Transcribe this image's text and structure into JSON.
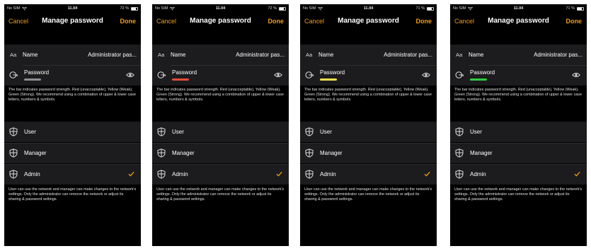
{
  "colors": {
    "accent": "#f39c12",
    "background": "#000000",
    "cell": "#1c1c1e",
    "strength_unacceptable": "#e74c3c",
    "strength_weak": "#f4e04d",
    "strength_strong": "#2ecc40",
    "strength_empty": "#8e8e93"
  },
  "screens": [
    {
      "status": {
        "carrier": "No SIM",
        "time": "11.04",
        "battery": "72 %",
        "battery_level": 0.72
      },
      "nav": {
        "cancel": "Cancel",
        "title": "Manage password",
        "done": "Done"
      },
      "name_row": {
        "icon_text": "Aa",
        "label": "Name",
        "value": "Administrator pas..."
      },
      "password_row": {
        "icon": "key-icon",
        "label": "Password",
        "strength": "empty",
        "reveal_icon": "eye-icon"
      },
      "hint": "The bar indicates password strength. Red (unacceptable), Yellow (Weak), Green (Strong). We recommend using a combination of upper & lower case letters, numbers & symbols.",
      "roles": [
        {
          "label": "User",
          "icon": "shield-icon",
          "selected": false
        },
        {
          "label": "Manager",
          "icon": "shield-icon",
          "selected": false
        },
        {
          "label": "Admin",
          "icon": "shield-icon",
          "selected": true
        }
      ],
      "footer": "User can use the network and manager can make changes to the network's settings. Only the administrator can remove the network or adjust its sharing & password settings."
    },
    {
      "status": {
        "carrier": "No SIM",
        "time": "11.04",
        "battery": "72 %",
        "battery_level": 0.72
      },
      "nav": {
        "cancel": "Cancel",
        "title": "Manage password",
        "done": "Done"
      },
      "name_row": {
        "icon_text": "Aa",
        "label": "Name",
        "value": "Administrator pas..."
      },
      "password_row": {
        "icon": "key-icon",
        "label": "Password",
        "strength": "unacceptable",
        "reveal_icon": "eye-icon"
      },
      "hint": "The bar indicates password strength. Red (unacceptable), Yellow (Weak), Green (Strong). We recommend using a combination of upper & lower case letters, numbers & symbols.",
      "roles": [
        {
          "label": "User",
          "icon": "shield-icon",
          "selected": false
        },
        {
          "label": "Manager",
          "icon": "shield-icon",
          "selected": false
        },
        {
          "label": "Admin",
          "icon": "shield-icon",
          "selected": true
        }
      ],
      "footer": "User can use the network and manager can make changes to the network's settings. Only the administrator can remove the network or adjust its sharing & password settings."
    },
    {
      "status": {
        "carrier": "No SIM",
        "time": "11.04",
        "battery": "71 %",
        "battery_level": 0.71
      },
      "nav": {
        "cancel": "Cancel",
        "title": "Manage password",
        "done": "Done"
      },
      "name_row": {
        "icon_text": "Aa",
        "label": "Name",
        "value": "Administrator pas..."
      },
      "password_row": {
        "icon": "key-icon",
        "label": "Password",
        "strength": "weak",
        "reveal_icon": "eye-icon"
      },
      "hint": "The bar indicates password strength. Red (unacceptable), Yellow (Weak), Green (Strong). We recommend using a combination of upper & lower case letters, numbers & symbols.",
      "roles": [
        {
          "label": "User",
          "icon": "shield-icon",
          "selected": false
        },
        {
          "label": "Manager",
          "icon": "shield-icon",
          "selected": false
        },
        {
          "label": "Admin",
          "icon": "shield-icon",
          "selected": true
        }
      ],
      "footer": "User can use the network and manager can make changes to the network's settings. Only the administrator can remove the network or adjust its sharing & password settings."
    },
    {
      "status": {
        "carrier": "No SIM",
        "time": "11.04",
        "battery": "71 %",
        "battery_level": 0.71
      },
      "nav": {
        "cancel": "Cancel",
        "title": "Manage password",
        "done": "Done"
      },
      "name_row": {
        "icon_text": "Aa",
        "label": "Name",
        "value": "Administrator pas..."
      },
      "password_row": {
        "icon": "key-icon",
        "label": "Password",
        "strength": "strong",
        "reveal_icon": "eye-icon"
      },
      "hint": "The bar indicates password strength. Red (unacceptable), Yellow (Weak), Green (Strong). We recommend using a combination of upper & lower case letters, numbers & symbols.",
      "roles": [
        {
          "label": "User",
          "icon": "shield-icon",
          "selected": false
        },
        {
          "label": "Manager",
          "icon": "shield-icon",
          "selected": false
        },
        {
          "label": "Admin",
          "icon": "shield-icon",
          "selected": true
        }
      ],
      "footer": "User can use the network and manager can make changes to the network's settings. Only the administrator can remove the network or adjust its sharing & password settings."
    }
  ]
}
